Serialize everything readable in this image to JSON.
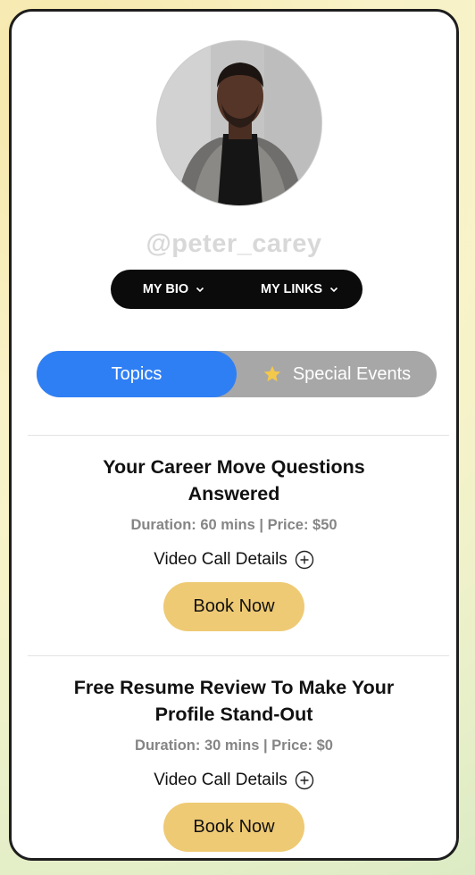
{
  "profile": {
    "username": "@peter_carey"
  },
  "nav": {
    "bio_label": "MY BIO",
    "links_label": "MY LINKS"
  },
  "tabs": {
    "topics_label": "Topics",
    "events_label": "Special Events",
    "active": "Topics"
  },
  "sessions": [
    {
      "title_line1": "Your Career Move Questions",
      "title_line2": "Answered",
      "meta": "Duration: 60 mins | Price: $50",
      "details_label": "Video Call Details",
      "button_label": "Book Now"
    },
    {
      "title_line1": "Free Resume Review To Make Your",
      "title_line2": "Profile Stand-Out",
      "meta": "Duration: 30 mins | Price: $0",
      "details_label": "Video Call Details",
      "button_label": "Book Now"
    }
  ],
  "colors": {
    "accent_blue": "#2f7ff4",
    "book_button": "#efca74",
    "tab_bg": "#a7a7a7",
    "star": "#f4c84a"
  },
  "icons": {
    "nav_chevron": "chevron-down-icon",
    "events_icon": "star-icon",
    "details_icon": "plus-circle-icon"
  }
}
